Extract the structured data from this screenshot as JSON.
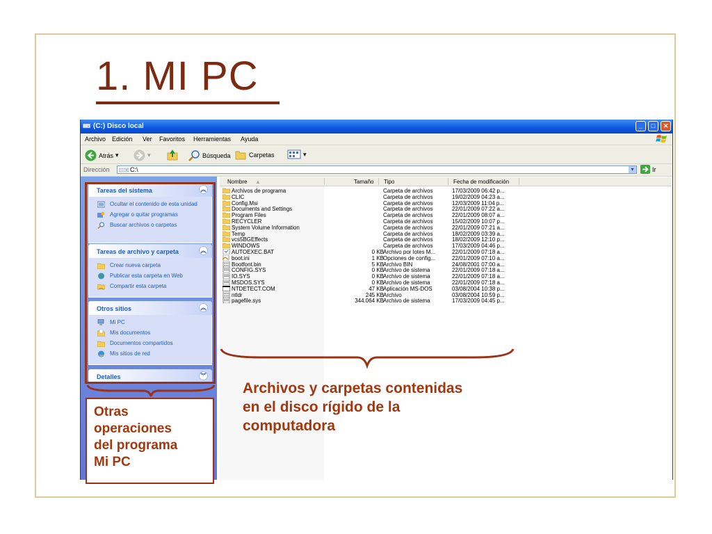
{
  "slide": {
    "title": "1. MI PC",
    "side_note_lines": [
      "Otras",
      "operaciones",
      "del programa",
      "Mi PC"
    ],
    "main_note_lines": [
      "Archivos y carpetas contenidas",
      "en el disco rígido de la",
      "computadora"
    ]
  },
  "window": {
    "title": "(C:) Disco local",
    "menu": [
      "Archivo",
      "Edición",
      "Ver",
      "Favoritos",
      "Herramientas",
      "Ayuda"
    ],
    "toolbar": {
      "back_label": "Atrás",
      "search_label": "Búsqueda",
      "folders_label": "Carpetas"
    },
    "address": {
      "label": "Dirección",
      "value": "C:\\",
      "go_label": "Ir"
    }
  },
  "left_pane": {
    "system_tasks": {
      "title": "Tareas del sistema",
      "items": [
        "Ocultar el contenido de esta unidad",
        "Agregar o quitar programas",
        "Buscar archivos o carpetas"
      ]
    },
    "file_tasks": {
      "title": "Tareas de archivo y carpeta",
      "items": [
        "Crear nueva carpeta",
        "Publicar esta carpeta en Web",
        "Compartir esta carpeta"
      ]
    },
    "other_places": {
      "title": "Otros sitios",
      "items": [
        "Mi PC",
        "Mis documentos",
        "Documentos compartidos",
        "Mis sitios de red"
      ]
    },
    "details": {
      "title": "Detalles"
    }
  },
  "file_list": {
    "columns": {
      "name": "Nombre",
      "size": "Tamaño",
      "type": "Tipo",
      "date": "Fecha de modificación"
    },
    "rows": [
      {
        "name": "Archivos de programa",
        "size": "",
        "type": "Carpeta de archivos",
        "date": "17/03/2009 06:42 p...",
        "icon": "folder-icon"
      },
      {
        "name": "CLIC",
        "size": "",
        "type": "Carpeta de archivos",
        "date": "19/02/2009 04:23 a...",
        "icon": "folder-icon"
      },
      {
        "name": "Config.Msi",
        "size": "",
        "type": "Carpeta de archivos",
        "date": "12/03/2009 11:04 p...",
        "icon": "folder-icon"
      },
      {
        "name": "Documents and Settings",
        "size": "",
        "type": "Carpeta de archivos",
        "date": "22/01/2009 07:22 a...",
        "icon": "folder-icon"
      },
      {
        "name": "Program Files",
        "size": "",
        "type": "Carpeta de archivos",
        "date": "22/01/2009 08:07 a...",
        "icon": "folder-icon"
      },
      {
        "name": "RECYCLER",
        "size": "",
        "type": "Carpeta de archivos",
        "date": "15/02/2009 10:07 p...",
        "icon": "folder-icon"
      },
      {
        "name": "System Volume Information",
        "size": "",
        "type": "Carpeta de archivos",
        "date": "22/01/2009 07:21 a...",
        "icon": "folder-icon"
      },
      {
        "name": "Temp",
        "size": "",
        "type": "Carpeta de archivos",
        "date": "18/02/2009 03:39 a...",
        "icon": "folder-icon"
      },
      {
        "name": "vcs5BGEffects",
        "size": "",
        "type": "Carpeta de archivos",
        "date": "18/02/2009 12:10 p...",
        "icon": "folder-icon"
      },
      {
        "name": "WINDOWS",
        "size": "",
        "type": "Carpeta de archivos",
        "date": "17/03/2009 04:46 p...",
        "icon": "folder-icon"
      },
      {
        "name": "AUTOEXEC.BAT",
        "size": "0 KB",
        "type": "Archivo por lotes M...",
        "date": "22/01/2009 07:18 a...",
        "icon": "batch-file-icon"
      },
      {
        "name": "boot.ini",
        "size": "1 KB",
        "type": "Opciones de config...",
        "date": "22/01/2009 07:10 a...",
        "icon": "config-file-icon"
      },
      {
        "name": "Bootfont.bin",
        "size": "5 KB",
        "type": "Archivo BIN",
        "date": "24/08/2001 07:00 a...",
        "icon": "file-icon"
      },
      {
        "name": "CONFIG.SYS",
        "size": "0 KB",
        "type": "Archivo de sistema",
        "date": "22/01/2009 07:18 a...",
        "icon": "system-file-icon"
      },
      {
        "name": "IO.SYS",
        "size": "0 KB",
        "type": "Archivo de sistema",
        "date": "22/01/2009 07:18 a...",
        "icon": "system-file-icon"
      },
      {
        "name": "MSDOS.SYS",
        "size": "0 KB",
        "type": "Archivo de sistema",
        "date": "22/01/2009 07:18 a...",
        "icon": "system-file-icon"
      },
      {
        "name": "NTDETECT.COM",
        "size": "47 KB",
        "type": "Aplicación MS-DOS",
        "date": "03/08/2004 10:38 p...",
        "icon": "msdos-app-icon"
      },
      {
        "name": "ntldr",
        "size": "245 KB",
        "type": "Archivo",
        "date": "03/08/2004 10:59 p...",
        "icon": "file-icon"
      },
      {
        "name": "pagefile.sys",
        "size": "344.064 KB",
        "type": "Archivo de sistema",
        "date": "17/03/2009 04:45 p...",
        "icon": "system-file-icon"
      }
    ]
  }
}
